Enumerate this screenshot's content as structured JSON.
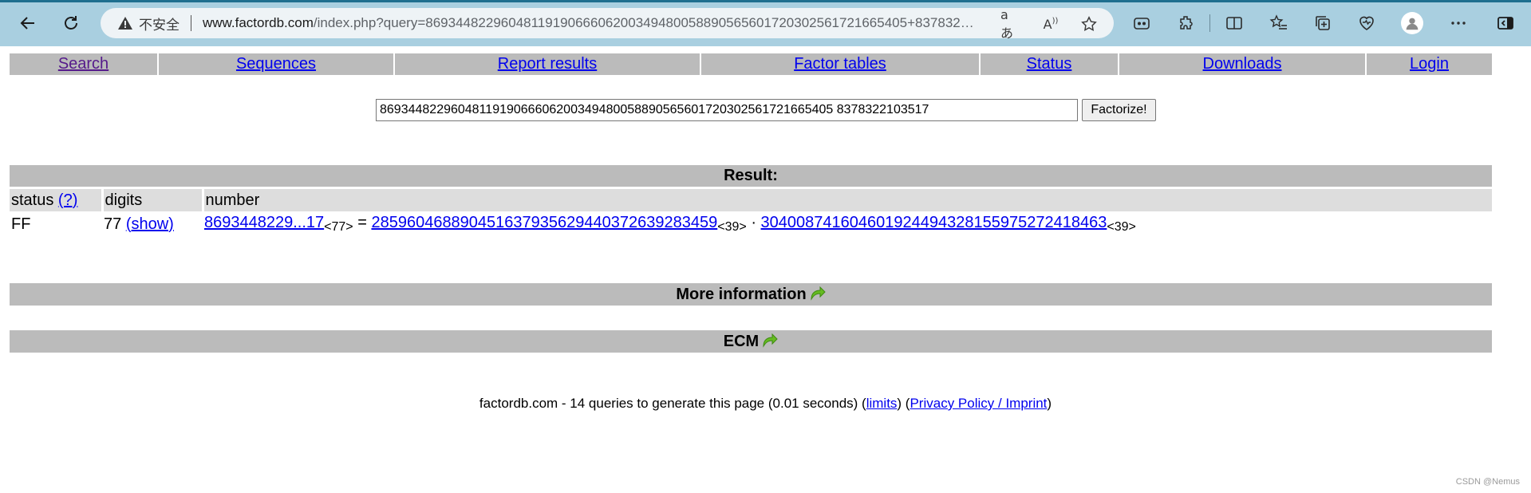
{
  "browser": {
    "security_label": "不安全",
    "url_host": "www.factordb.com",
    "url_rest": "/index.php?query=8693448229604811919066606200349480058890565601720302561721665405+837832…",
    "read_aloud_glyph": "A",
    "translate_glyph": "aあ"
  },
  "menu": {
    "search": "Search",
    "sequences": "Sequences",
    "report_results": "Report results",
    "factor_tables": "Factor tables",
    "status": "Status",
    "downloads": "Downloads",
    "login": "Login"
  },
  "search": {
    "query_value": "8693448229604811919066606200349480058890565601720302561721665405 8378322103517",
    "button_label": "Factorize!"
  },
  "result": {
    "title": "Result:",
    "headers": {
      "status": "status",
      "status_help": "(?)",
      "digits": "digits",
      "number": "number"
    },
    "row": {
      "status": "FF",
      "digits": "77",
      "show_link": "(show)",
      "number_short": "8693448229...17",
      "number_digits": "<77>",
      "equals": "=",
      "factor1": "285960468890451637935629440372639283459",
      "factor1_digits": "<39>",
      "times": "·",
      "factor2": "304008741604601924494328155975272418463",
      "factor2_digits": "<39>"
    }
  },
  "sections": {
    "more_info": "More information",
    "ecm": "ECM"
  },
  "footer": {
    "prefix": "factordb.com - 14 queries to generate this page (0.01 seconds) (",
    "limits": "limits",
    "middle": ") (",
    "privacy": "Privacy Policy / Imprint",
    "suffix": ")"
  },
  "watermark": "CSDN @Nemus",
  "colors": {
    "chrome": "#a9cfe0",
    "menu_bar": "#bbbbbb",
    "link": "#0000ee",
    "visited": "#551a8b",
    "arrow": "#66bb22"
  }
}
